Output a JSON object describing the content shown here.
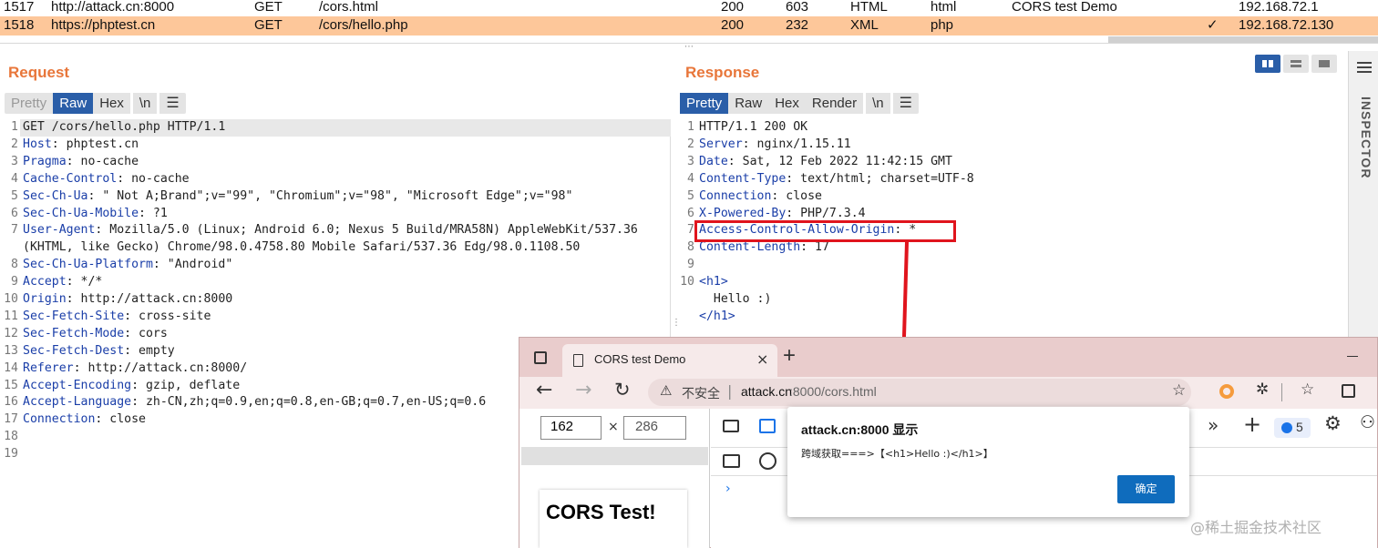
{
  "history": {
    "rows": [
      {
        "id": "1517",
        "host": "http://attack.cn:8000",
        "method": "GET",
        "url": "/cors.html",
        "status": "200",
        "length": "603",
        "mime": "HTML",
        "ext": "html",
        "title": "CORS test Demo",
        "check": "",
        "ip": "192.168.72.1"
      },
      {
        "id": "1518",
        "host": "https://phptest.cn",
        "method": "GET",
        "url": "/cors/hello.php",
        "status": "200",
        "length": "232",
        "mime": "XML",
        "ext": "php",
        "title": "",
        "check": "✓",
        "ip": "192.168.72.130"
      }
    ]
  },
  "request": {
    "title": "Request",
    "tabs": [
      "Pretty",
      "Raw",
      "Hex",
      "\\n"
    ],
    "active_tab": "Raw",
    "lines": [
      {
        "n": "1",
        "h": "GET /cors/hello.php HTTP/1.1",
        "v": ""
      },
      {
        "n": "2",
        "h": "Host",
        "v": ": phptest.cn"
      },
      {
        "n": "3",
        "h": "Pragma",
        "v": ": no-cache"
      },
      {
        "n": "4",
        "h": "Cache-Control",
        "v": ": no-cache"
      },
      {
        "n": "5",
        "h": "Sec-Ch-Ua",
        "v": ": \" Not A;Brand\";v=\"99\", \"Chromium\";v=\"98\", \"Microsoft Edge\";v=\"98\""
      },
      {
        "n": "6",
        "h": "Sec-Ch-Ua-Mobile",
        "v": ": ?1"
      },
      {
        "n": "7",
        "h": "User-Agent",
        "v": ": Mozilla/5.0 (Linux; Android 6.0; Nexus 5 Build/MRA58N) AppleWebKit/537.36"
      },
      {
        "n": "",
        "h": "",
        "v": "(KHTML, like Gecko) Chrome/98.0.4758.80 Mobile Safari/537.36 Edg/98.0.1108.50"
      },
      {
        "n": "8",
        "h": "Sec-Ch-Ua-Platform",
        "v": ": \"Android\""
      },
      {
        "n": "9",
        "h": "Accept",
        "v": ": */*"
      },
      {
        "n": "10",
        "h": "Origin",
        "v": ": http://attack.cn:8000"
      },
      {
        "n": "11",
        "h": "Sec-Fetch-Site",
        "v": ": cross-site"
      },
      {
        "n": "12",
        "h": "Sec-Fetch-Mode",
        "v": ": cors"
      },
      {
        "n": "13",
        "h": "Sec-Fetch-Dest",
        "v": ": empty"
      },
      {
        "n": "14",
        "h": "Referer",
        "v": ": http://attack.cn:8000/"
      },
      {
        "n": "15",
        "h": "Accept-Encoding",
        "v": ": gzip, deflate"
      },
      {
        "n": "16",
        "h": "Accept-Language",
        "v": ": zh-CN,zh;q=0.9,en;q=0.8,en-GB;q=0.7,en-US;q=0.6"
      },
      {
        "n": "17",
        "h": "Connection",
        "v": ": close"
      },
      {
        "n": "18",
        "h": "",
        "v": ""
      },
      {
        "n": "19",
        "h": "",
        "v": ""
      }
    ]
  },
  "response": {
    "title": "Response",
    "tabs": [
      "Pretty",
      "Raw",
      "Hex",
      "Render",
      "\\n"
    ],
    "active_tab": "Pretty",
    "lines": [
      {
        "n": "1",
        "h": "",
        "v": "HTTP/1.1 200 OK"
      },
      {
        "n": "2",
        "h": "Server",
        "v": ": nginx/1.15.11"
      },
      {
        "n": "3",
        "h": "Date",
        "v": ": Sat, 12 Feb 2022 11:42:15 GMT"
      },
      {
        "n": "4",
        "h": "Content-Type",
        "v": ": text/html; charset=UTF-8"
      },
      {
        "n": "5",
        "h": "Connection",
        "v": ": close"
      },
      {
        "n": "6",
        "h": "X-Powered-By",
        "v": ": PHP/7.3.4"
      },
      {
        "n": "7",
        "h": "Access-Control-Allow-Origin",
        "v": ": *"
      },
      {
        "n": "8",
        "h": "Content-Length",
        "v": ": 17"
      },
      {
        "n": "9",
        "h": "",
        "v": ""
      },
      {
        "n": "10",
        "h": "<h1>",
        "v": ""
      },
      {
        "n": "",
        "h": "",
        "v": "  Hello :)"
      },
      {
        "n": "",
        "h": "</h1>",
        "v": ""
      }
    ]
  },
  "inspector_label": "INSPECTOR",
  "browser": {
    "tab_title": "CORS test Demo",
    "new_tab": "+",
    "insecure_label": "不安全",
    "url_host": "attack.cn",
    "url_rest": ":8000/cors.html",
    "devtools": {
      "width": "162",
      "times": "×",
      "height": "286",
      "badge": "5"
    },
    "page_heading": "CORS Test!",
    "alert": {
      "title": "attack.cn:8000 显示",
      "message": "跨域获取===>【<h1>Hello :)</h1>】",
      "ok_label": "确定"
    }
  },
  "watermark": "@稀土掘金技术社区",
  "colors": {
    "accent": "#e8763a",
    "selected_row": "#fdc79a",
    "tab_active": "#2a5ea8",
    "highlight": "#e0141d",
    "button": "#0f6cbd"
  }
}
